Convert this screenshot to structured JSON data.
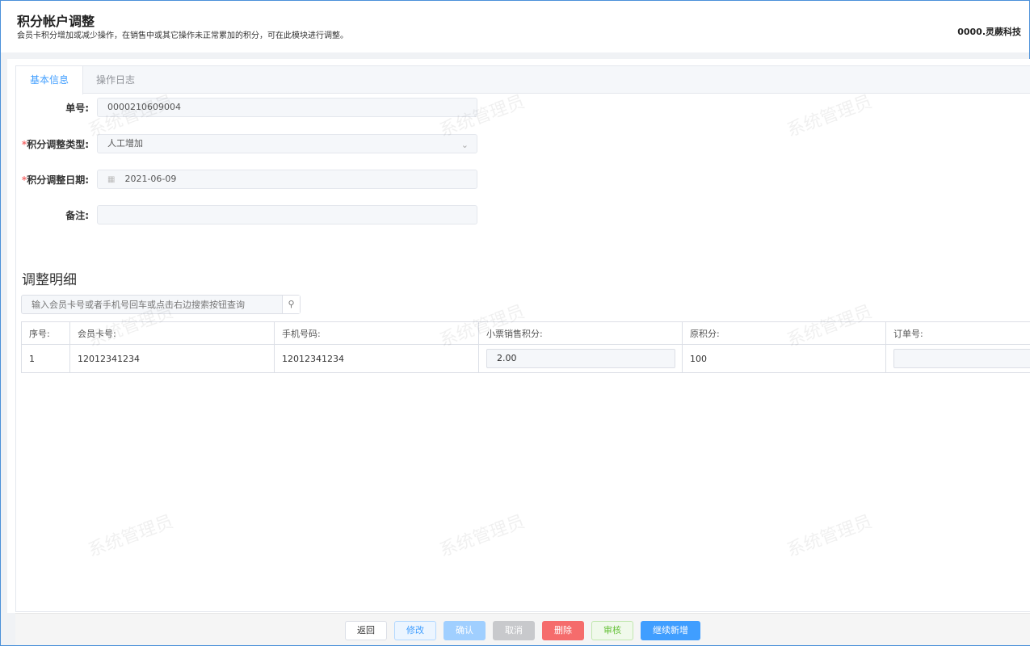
{
  "header": {
    "title": "积分帐户调整",
    "subtitle": "会员卡积分增加或减少操作，在销售中或其它操作未正常累加的积分，可在此模块进行调整。",
    "company": "0000.灵蕨科技"
  },
  "tabs": [
    {
      "label": "基本信息",
      "active": true
    },
    {
      "label": "操作日志",
      "active": false
    }
  ],
  "form": {
    "order_no": {
      "label": "单号:",
      "value": "0000210609004"
    },
    "adjust_type": {
      "required": "*",
      "label": "积分调整类型:",
      "value": "人工增加"
    },
    "adjust_date": {
      "required": "*",
      "label": "积分调整日期:",
      "value": "2021-06-09"
    },
    "remark": {
      "label": "备注:",
      "value": ""
    }
  },
  "details": {
    "title": "调整明细",
    "search_placeholder": "输入会员卡号或者手机号回车或点击右边搜索按钮查询",
    "columns": [
      "序号:",
      "会员卡号:",
      "手机号码:",
      "小票销售积分:",
      "原积分:",
      "订单号:"
    ],
    "rows": [
      {
        "index": "1",
        "card": "12012341234",
        "phone": "12012341234",
        "ticket_points": "2.00",
        "original_points": "100",
        "order_no": ""
      }
    ]
  },
  "buttons": {
    "back": "返回",
    "edit": "修改",
    "confirm": "确认",
    "cancel": "取消",
    "delete": "删除",
    "audit": "审核",
    "continue_add": "继续新增"
  },
  "watermark": "系统管理员",
  "colors": {
    "primary": "#409eff",
    "danger": "#f56c6c",
    "success": "#67c23a"
  }
}
